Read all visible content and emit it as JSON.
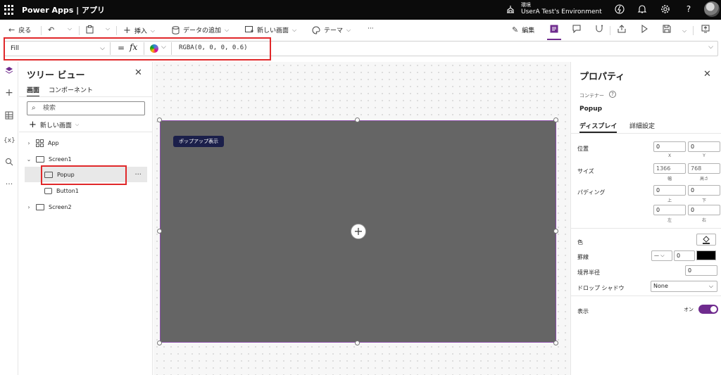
{
  "header": {
    "brand": "Power Apps | アプリ",
    "env_label": "環境",
    "env_name": "UserA Test's Environment",
    "icons": [
      "waffle-icon",
      "environment-icon",
      "bolt-icon",
      "bell-icon",
      "gear-icon",
      "help-icon",
      "avatar"
    ]
  },
  "cmdbar": {
    "back": "戻る",
    "insert": "挿入",
    "add_data": "データの追加",
    "new_screen": "新しい画面",
    "theme": "テーマ",
    "more": "···",
    "edit": "編集"
  },
  "formula": {
    "property": "Fill",
    "eq": "=",
    "fx": "fx",
    "expression": "RGBA(0, 0, 0, 0.6)"
  },
  "tree": {
    "title": "ツリー ビュー",
    "tabs": [
      "画面",
      "コンポーネント"
    ],
    "search_placeholder": "検索",
    "new_screen": "新しい画面",
    "nodes": [
      "App",
      "Screen1",
      "Popup",
      "Button1",
      "Screen2"
    ]
  },
  "canvas": {
    "badge": "ポップアップ表示",
    "popup_fill": "#656565"
  },
  "props": {
    "title": "プロパティ",
    "container_type": "コンテナー",
    "control_name": "Popup",
    "tabs": [
      "ディスプレイ",
      "詳細設定"
    ],
    "position_label": "位置",
    "x": "0",
    "y": "0",
    "x_label": "X",
    "y_label": "Y",
    "size_label": "サイズ",
    "width": "1366",
    "height": "768",
    "width_label": "幅",
    "height_label": "高さ",
    "padding_label": "パディング",
    "pad_top": "0",
    "pad_bottom": "0",
    "pad_left": "0",
    "pad_right": "0",
    "pad_top_label": "上",
    "pad_bottom_label": "下",
    "pad_left_label": "左",
    "pad_right_label": "右",
    "color_label": "色",
    "border_label": "罫線",
    "border_width": "0",
    "border_color": "#000000",
    "radius_label": "境界半径",
    "radius": "0",
    "shadow_label": "ドロップ シャドウ",
    "shadow_value": "None",
    "visible_label": "表示",
    "visible_value": "オン",
    "accent": "#6f2b8e"
  }
}
